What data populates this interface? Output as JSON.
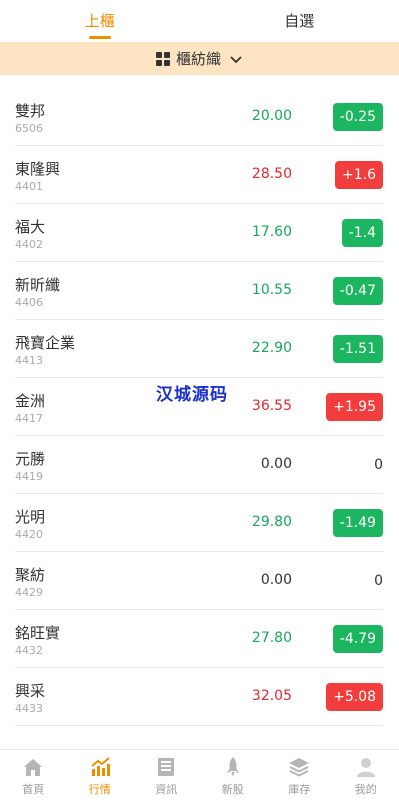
{
  "tabs": [
    {
      "label": "上櫃",
      "active": true
    },
    {
      "label": "自選",
      "active": false
    }
  ],
  "category": {
    "label": "櫃紡織",
    "icon": "grid-icon",
    "dropdown_icon": "chevron-down-icon"
  },
  "stocks": [
    {
      "name": "雙邦",
      "code": "6506",
      "price": "20.00",
      "change": "-0.25",
      "trend": "down"
    },
    {
      "name": "東隆興",
      "code": "4401",
      "price": "28.50",
      "change": "+1.6",
      "trend": "up"
    },
    {
      "name": "福大",
      "code": "4402",
      "price": "17.60",
      "change": "-1.4",
      "trend": "down"
    },
    {
      "name": "新昕纖",
      "code": "4406",
      "price": "10.55",
      "change": "-0.47",
      "trend": "down"
    },
    {
      "name": "飛寶企業",
      "code": "4413",
      "price": "22.90",
      "change": "-1.51",
      "trend": "down"
    },
    {
      "name": "金洲",
      "code": "4417",
      "price": "36.55",
      "change": "+1.95",
      "trend": "up"
    },
    {
      "name": "元勝",
      "code": "4419",
      "price": "0.00",
      "change": "0",
      "trend": "flat"
    },
    {
      "name": "光明",
      "code": "4420",
      "price": "29.80",
      "change": "-1.49",
      "trend": "down"
    },
    {
      "name": "聚紡",
      "code": "4429",
      "price": "0.00",
      "change": "0",
      "trend": "flat"
    },
    {
      "name": "銘旺實",
      "code": "4432",
      "price": "27.80",
      "change": "-4.79",
      "trend": "down"
    },
    {
      "name": "興采",
      "code": "4433",
      "price": "32.05",
      "change": "+5.08",
      "trend": "up"
    }
  ],
  "watermark": "汉城源码",
  "bottom_nav": [
    {
      "label": "首頁",
      "icon": "home-icon",
      "active": false
    },
    {
      "label": "行情",
      "icon": "chart-icon",
      "active": true
    },
    {
      "label": "資訊",
      "icon": "news-icon",
      "active": false
    },
    {
      "label": "新股",
      "icon": "rocket-icon",
      "active": false
    },
    {
      "label": "庫存",
      "icon": "layers-icon",
      "active": false
    },
    {
      "label": "我的",
      "icon": "user-icon",
      "active": false
    }
  ],
  "colors": {
    "accent": "#f08c00",
    "up": "#f23d3d",
    "down": "#1cb560",
    "category_bg": "#fde5c4"
  }
}
